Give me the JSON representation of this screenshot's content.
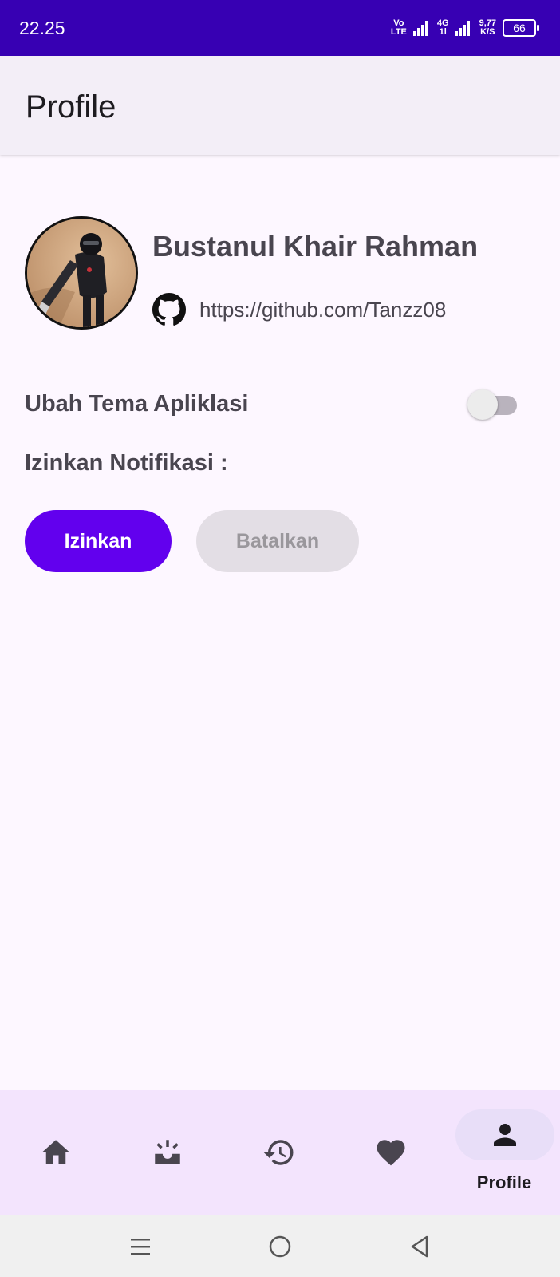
{
  "status_bar": {
    "time": "22.25",
    "volte_top": "Vo",
    "volte_bottom": "LTE",
    "network_top": "4G",
    "network_bottom": "1l",
    "speed_value": "9,77",
    "speed_unit": "K/S",
    "battery": "66"
  },
  "app_bar": {
    "title": "Profile"
  },
  "profile": {
    "name": "Bustanul Khair Rahman",
    "github_url": "https://github.com/Tanzz08"
  },
  "settings": {
    "theme_label": "Ubah Tema Apliklasi",
    "theme_enabled": false,
    "notification_label": "Izinkan Notifikasi :",
    "allow_button": "Izinkan",
    "cancel_button": "Batalkan"
  },
  "bottom_nav": {
    "items": [
      {
        "icon": "home-icon",
        "label": "",
        "selected": false
      },
      {
        "icon": "upcoming-icon",
        "label": "",
        "selected": false
      },
      {
        "icon": "history-icon",
        "label": "",
        "selected": false
      },
      {
        "icon": "favorite-icon",
        "label": "",
        "selected": false
      },
      {
        "icon": "person-icon",
        "label": "Profile",
        "selected": true
      }
    ]
  },
  "system_nav": {
    "buttons": [
      "menu-icon",
      "home-circle-icon",
      "back-icon"
    ]
  },
  "colors": {
    "status_bar": "#3700b3",
    "primary_button": "#6200ee",
    "background": "#fdf7ff",
    "bottom_nav": "#f3e4fd"
  }
}
